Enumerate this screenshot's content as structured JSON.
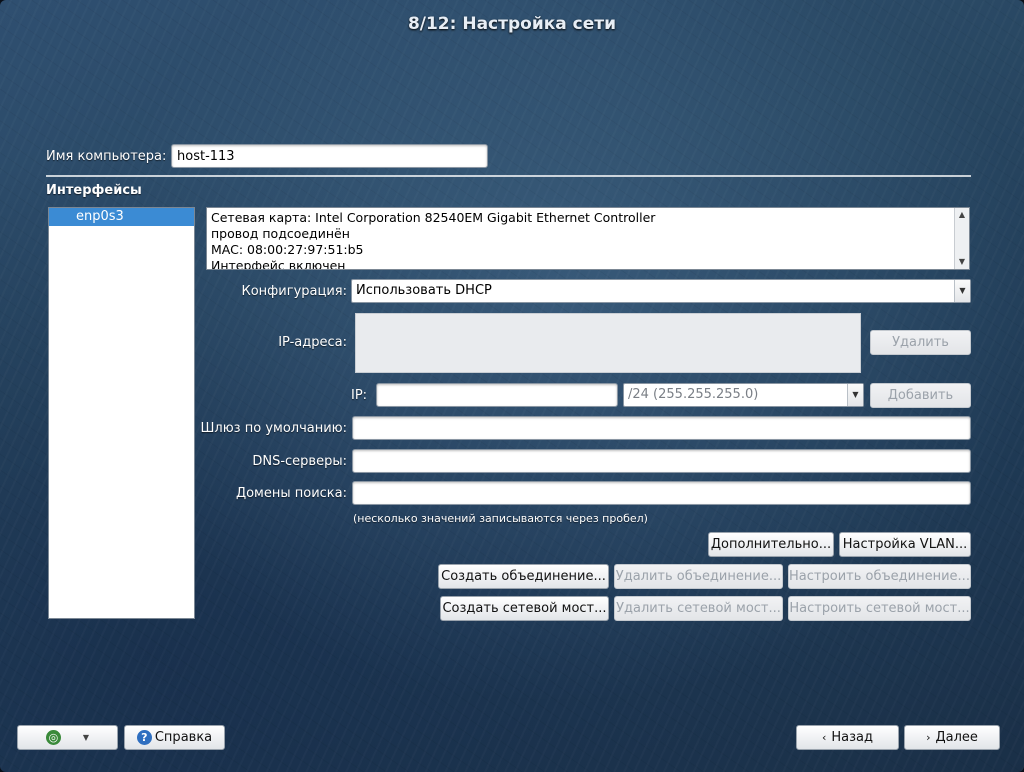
{
  "window": {
    "title": "8/12: Настройка сети"
  },
  "hostname": {
    "label": "Имя компьютера:",
    "value": "host-113"
  },
  "interfaces": {
    "section_label": "Интерфейсы",
    "items": [
      {
        "name": "enp0s3",
        "selected": true
      }
    ],
    "info_lines": [
      "Сетевая карта: Intel Corporation 82540EM Gigabit Ethernet Controller",
      "провод подсоединён",
      "MAC: 08:00:27:97:51:b5",
      "Интерфейс включен"
    ]
  },
  "configuration": {
    "label": "Конфигурация:",
    "value": "Использовать DHCP"
  },
  "ip_addresses": {
    "label": "IP-адреса:",
    "delete_button": "Удалить"
  },
  "ip_input": {
    "label": "IP:",
    "value": "",
    "mask_value": "/24 (255.255.255.0)",
    "add_button": "Добавить"
  },
  "gateway": {
    "label": "Шлюз по умолчанию:",
    "value": ""
  },
  "dns": {
    "label": "DNS-серверы:",
    "value": ""
  },
  "search_domains": {
    "label": "Домены поиска:",
    "value": "",
    "hint": "(несколько значений записываются через пробел)"
  },
  "buttons": {
    "advanced": "Дополнительно...",
    "vlan": "Настройка VLAN...",
    "create_bond": "Создать объединение...",
    "delete_bond": "Удалить объединение...",
    "configure_bond": "Настроить объединение...",
    "create_bridge": "Создать сетевой мост...",
    "delete_bridge": "Удалить сетевой мост...",
    "configure_bridge": "Настроить сетевой мост..."
  },
  "footer": {
    "help": "Справка",
    "back": "Назад",
    "next": "Далее"
  },
  "icons": {
    "footer_left": "globe-icon",
    "help": "help-icon",
    "back": "chevron-left-icon",
    "next": "chevron-right-icon"
  },
  "colors": {
    "background": "#294863",
    "selection": "#3b8bd4"
  }
}
